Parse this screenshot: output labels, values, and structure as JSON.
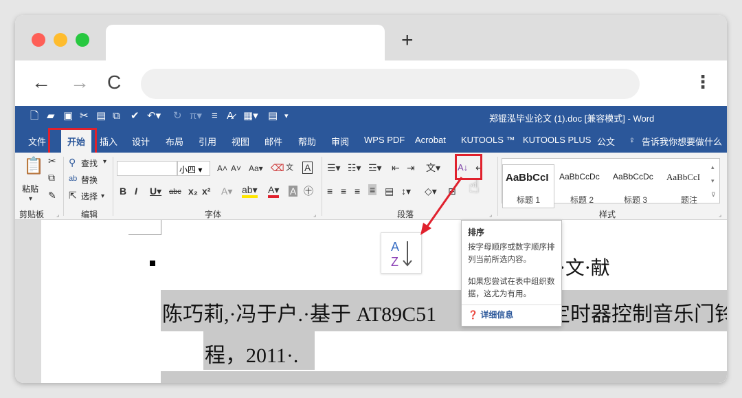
{
  "browser": {
    "new_tab": "+",
    "back": "←",
    "forward": "→",
    "reload": "C",
    "menu": "⋮"
  },
  "word": {
    "document_title": "郑锟泓毕业论文 (1).doc [兼容模式] - Word",
    "tabs": [
      "文件",
      "开始",
      "插入",
      "设计",
      "布局",
      "引用",
      "视图",
      "邮件",
      "帮助",
      "审阅",
      "WPS PDF",
      "Acrobat",
      "KUTOOLS ™",
      "KUTOOLS PLUS",
      "公文"
    ],
    "tell_me": "告诉我你想要做什么",
    "clipboard": {
      "paste": "粘贴",
      "group": "剪贴板"
    },
    "editing": {
      "find": "查找",
      "replace": "替换",
      "select": "选择",
      "group": "编辑"
    },
    "font": {
      "font_size": "小四",
      "group": "字体"
    },
    "paragraph": {
      "group": "段落"
    },
    "styles": {
      "group": "样式",
      "items": [
        {
          "sample": "AaBbCcI",
          "name": "标题 1"
        },
        {
          "sample": "AaBbCcDc",
          "name": "标题 2"
        },
        {
          "sample": "AaBbCcDc",
          "name": "标题 3"
        },
        {
          "sample": "AaBbCcI",
          "name": "题注"
        }
      ]
    }
  },
  "document": {
    "heading": "·文·献",
    "para1": "陈巧莉,·冯于户.·基于 AT89C51 ",
    "para1_tail": "定时器控制音乐门铃",
    "para2": "程，2011·."
  },
  "tooltip": {
    "title": "排序",
    "desc": "按字母顺序或数字顺序排列当前所选内容。",
    "hint": "如果您尝试在表中组织数据，这尤为有用。",
    "more": "详细信息"
  },
  "colors": {
    "word_blue": "#2b579a",
    "highlight": "#e0212d"
  }
}
